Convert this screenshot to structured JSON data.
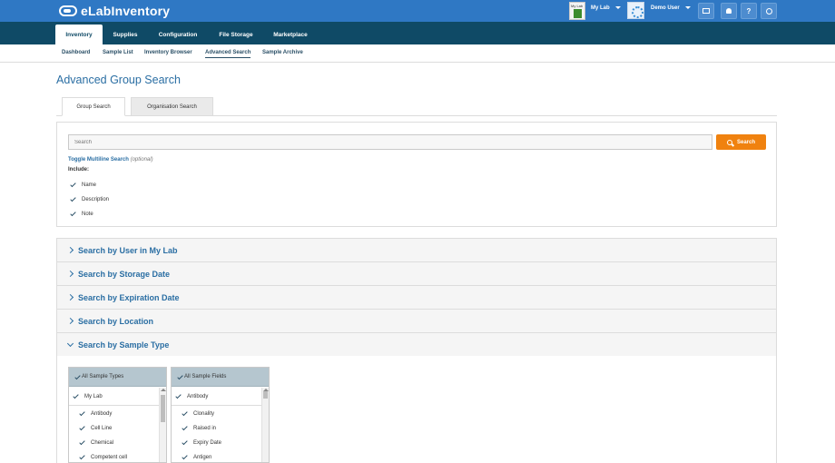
{
  "app": {
    "name": "eLabInventory"
  },
  "topbar": {
    "lab_thumb_label": "My Lab",
    "lab_dropdown": "My Lab",
    "user_dropdown": "Demo User",
    "buttons": [
      {
        "name": "storage-icon",
        "glyph": "▭"
      },
      {
        "name": "bell-icon",
        "glyph": "🔔"
      },
      {
        "name": "help-icon",
        "glyph": "?"
      },
      {
        "name": "power-icon",
        "glyph": "⏻"
      }
    ]
  },
  "mainnav": [
    "Inventory",
    "Supplies",
    "Configuration",
    "File Storage",
    "Marketplace"
  ],
  "subnav": [
    "Dashboard",
    "Sample List",
    "Inventory Browser",
    "Advanced Search",
    "Sample Archive"
  ],
  "page": {
    "title": "Advanced Group Search"
  },
  "tabs": [
    "Group Search",
    "Organisation Search"
  ],
  "search": {
    "placeholder": "Search",
    "button_label": "Search",
    "toggle_label": "Toggle Multiline Search",
    "toggle_optional": "(optional)",
    "include_label": "Include:",
    "include_options": [
      "Name",
      "Description",
      "Note"
    ]
  },
  "accordion": [
    "Search by User in My Lab",
    "Search by Storage Date",
    "Search by Expiration Date",
    "Search by Location",
    "Search by Sample Type"
  ],
  "sample_types": {
    "header": "All Sample Types",
    "group": "My Lab",
    "items": [
      "Antibody",
      "Cell Line",
      "Chemical",
      "Competent cell"
    ]
  },
  "sample_fields": {
    "header": "All Sample Fields",
    "group": "Antibody",
    "items": [
      "Clonality",
      "Raised in",
      "Expiry Date",
      "Antigen"
    ]
  },
  "colors": {
    "brand": "#2f78c4",
    "nav": "#0f4a66",
    "accent": "#f0820f",
    "link": "#2a6ea3"
  }
}
